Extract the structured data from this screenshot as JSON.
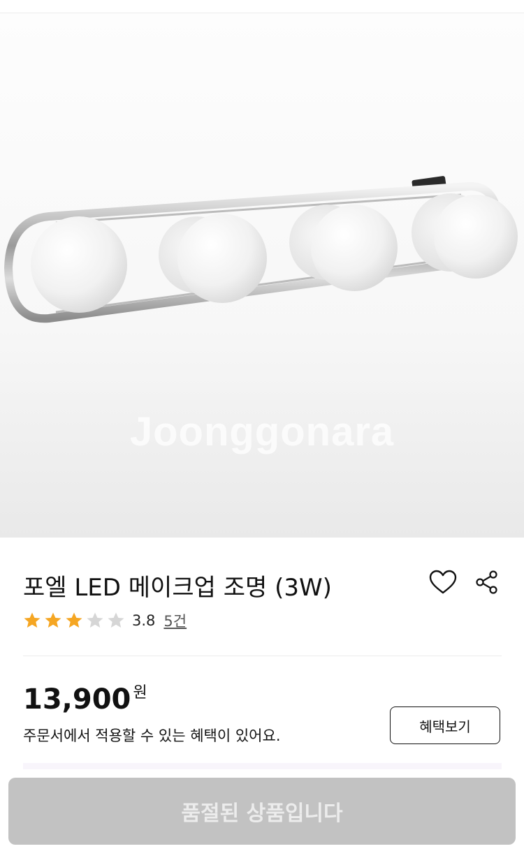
{
  "product": {
    "watermark": "Joonggonara",
    "title": "포엘 LED 메이크업 조명 (3W)",
    "rating": "3.8",
    "rating_stars": 3.8,
    "review_count": "5건",
    "price": "13,900",
    "currency": "원",
    "benefit_text": "주문서에서 적용할 수 있는 혜택이 있어요.",
    "benefit_button": "혜택보기"
  },
  "icons": {
    "heart": "heart-icon",
    "share": "share-icon",
    "star": "star-icon"
  },
  "colors": {
    "star_filled": "#F5A623",
    "star_empty": "#D6D6D6",
    "soldout_bg": "#C2C2C2"
  },
  "bottom": {
    "soldout_label": "품절된 상품입니다"
  }
}
